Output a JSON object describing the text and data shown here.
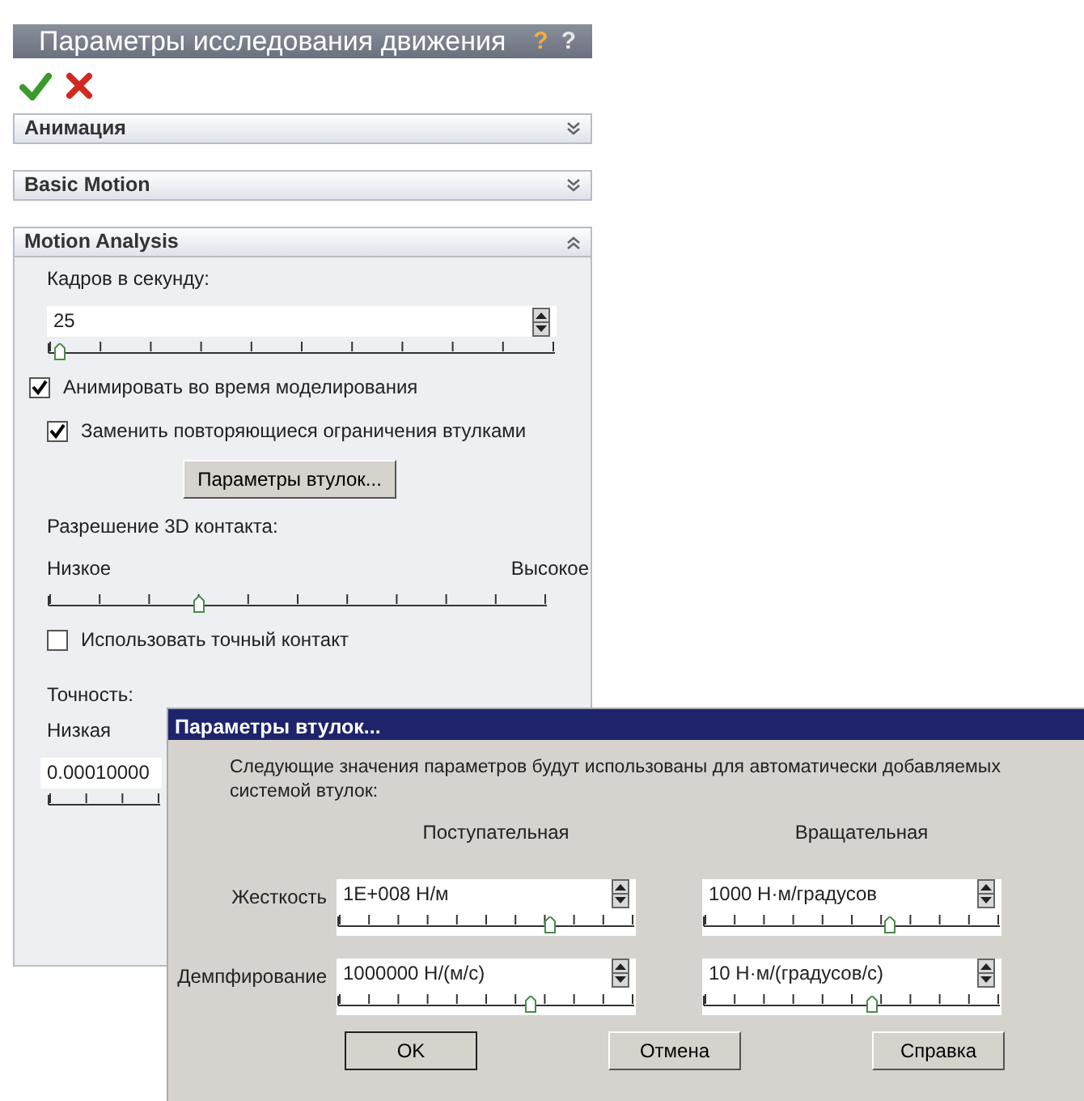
{
  "panel": {
    "title": "Параметры исследования движения",
    "help_icons": [
      "?",
      "?"
    ],
    "sections": [
      {
        "title": "Анимация",
        "expanded": false
      },
      {
        "title": "Basic Motion",
        "expanded": false
      },
      {
        "title": "Motion Analysis",
        "expanded": true
      }
    ],
    "frames": {
      "label": "Кадров в секунду:",
      "value": "25",
      "level": 0.02
    },
    "checks": [
      {
        "label": "Анимировать во время моделирования",
        "checked": true
      },
      {
        "label": "Заменить повторяющиеся ограничения втулками",
        "checked": true
      }
    ],
    "bushing_button": "Параметры втулок...",
    "contact": {
      "label": "Разрешение 3D контакта:",
      "low": "Низкое",
      "high": "Высокое",
      "level": 0.3
    },
    "precise_contact": {
      "label": "Использовать точный контакт",
      "checked": false
    },
    "accuracy": {
      "label": "Точность:",
      "low": "Низкая",
      "value": "0.00010000"
    }
  },
  "dialog": {
    "title": "Параметры втулок...",
    "description": "Следующие значения параметров будут использованы для автоматически добавляемых системой втулок:",
    "columns": [
      "Поступательная",
      "Вращательная"
    ],
    "rows": [
      {
        "label": "Жесткость",
        "cells": [
          {
            "value": "1E+008 Н/м",
            "level": 0.72
          },
          {
            "value": "1000 Н·м/градусов",
            "level": 0.63
          }
        ]
      },
      {
        "label": "Демпфирование",
        "cells": [
          {
            "value": "1000000 Н/(м/с)",
            "level": 0.65
          },
          {
            "value": "10 Н·м/(градусов/с)",
            "level": 0.57
          }
        ]
      }
    ],
    "buttons": [
      "OK",
      "Отмена",
      "Справка"
    ]
  }
}
